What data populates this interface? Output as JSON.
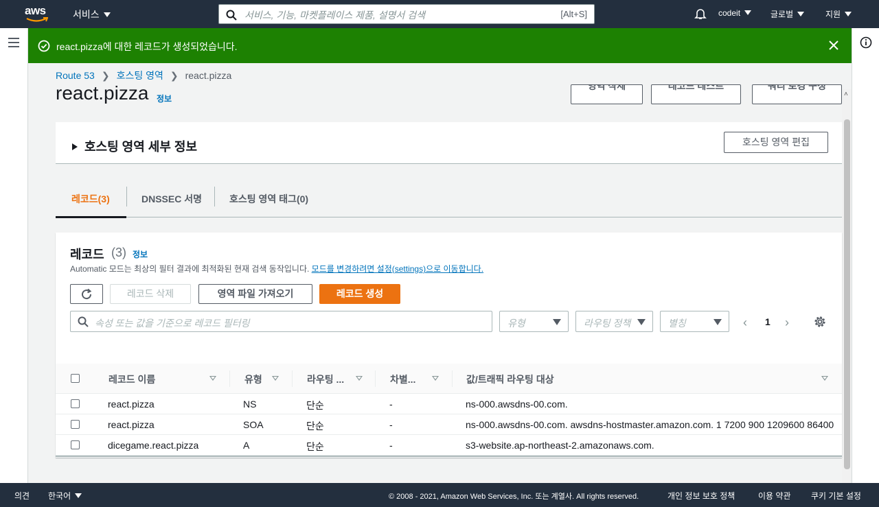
{
  "topnav": {
    "logo_text": "aws",
    "services_label": "서비스",
    "search_placeholder": "서비스, 기능, 마켓플레이스 제품, 설명서 검색",
    "search_shortcut": "[Alt+S]",
    "account_label": "codeit",
    "region_label": "글로벌",
    "support_label": "지원"
  },
  "flash": {
    "message": "react.pizza에 대한 레코드가 생성되었습니다.",
    "color": "#1d8102"
  },
  "breadcrumb": [
    "Route 53",
    "호스팅 영역",
    "react.pizza"
  ],
  "page": {
    "title": "react.pizza",
    "info_label": "정보",
    "buttons": [
      "영역 삭제",
      "레코드 테스트",
      "쿼리 로깅 구성"
    ]
  },
  "details": {
    "title": "호스팅 영역 세부 정보",
    "edit_button": "호스팅 영역 편집"
  },
  "tabs": [
    {
      "label": "레코드(3)",
      "active": true
    },
    {
      "label": "DNSSEC 서명",
      "active": false
    },
    {
      "label": "호스팅 영역 태그(0)",
      "active": false
    }
  ],
  "records": {
    "heading": "레코드",
    "count": "(3)",
    "info_label": "정보",
    "description": "Automatic 모드는 최상의 필터 결과에 최적화된 현재 검색 동작입니다.",
    "description_link": "모드를 변경하려면 설정(settings)으로 이동합니다.",
    "buttons": {
      "refresh_icon": "refresh-icon",
      "delete": "레코드 삭제",
      "import": "영역 파일 가져오기",
      "create": "레코드 생성"
    },
    "filter_placeholder": "속성 또는 값을 기준으로 레코드 필터링",
    "type_select": "유형",
    "routing_select": "라우팅 정책",
    "alias_select": "별칭",
    "page_number": "1",
    "columns": [
      "레코드 이름",
      "유형",
      "라우팅 ...",
      "차별...",
      "값/트래픽 라우팅 대상"
    ],
    "rows": [
      {
        "name": "react.pizza",
        "type": "NS",
        "routing": "단순",
        "diff": "-",
        "value": "ns-000.awsdns-00.com."
      },
      {
        "name": "react.pizza",
        "type": "SOA",
        "routing": "단순",
        "diff": "-",
        "value": "ns-000.awsdns-00.com. awsdns-hostmaster.amazon.com. 1 7200 900 1209600 86400"
      },
      {
        "name": "dicegame.react.pizza",
        "type": "A",
        "routing": "단순",
        "diff": "-",
        "value": "s3-website.ap-northeast-2.amazonaws.com."
      }
    ],
    "accent_color": "#ec7211"
  },
  "footer": {
    "feedback": "의견",
    "language": "한국어",
    "copyright": "© 2008 - 2021, Amazon Web Services, Inc. 또는 계열사. All rights reserved.",
    "privacy": "개인 정보 보호 정책",
    "terms": "이용 약관",
    "cookies": "쿠키 기본 설정"
  }
}
